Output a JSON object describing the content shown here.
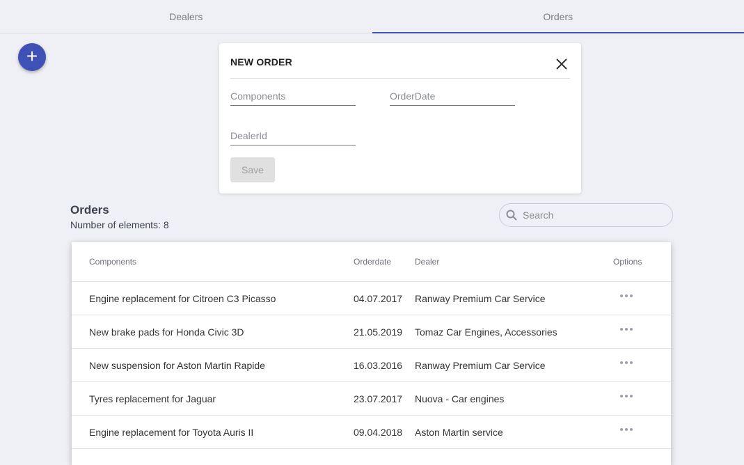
{
  "tabs": [
    {
      "label": "Dealers",
      "active": false
    },
    {
      "label": "Orders",
      "active": true
    }
  ],
  "colors": {
    "accent": "#3f51b5"
  },
  "fab": {
    "icon": "plus-icon",
    "label": "+"
  },
  "dialog": {
    "title": "NEW ORDER",
    "close_icon": "close-icon",
    "fields": {
      "components": {
        "placeholder": "Components",
        "value": ""
      },
      "order_date": {
        "placeholder": "OrderDate",
        "value": ""
      },
      "dealer_id": {
        "placeholder": "DealerId",
        "value": ""
      }
    },
    "save_label": "Save"
  },
  "orders": {
    "title": "Orders",
    "count_text": "Number of elements: 8",
    "search": {
      "placeholder": "Search",
      "icon": "search-icon"
    },
    "columns": [
      "Components",
      "Orderdate",
      "Dealer",
      "Options"
    ],
    "rows": [
      {
        "components": "Engine replacement for Citroen C3 Picasso",
        "date": "04.07.2017",
        "dealer": "Ranway Premium Car Service"
      },
      {
        "components": "New brake pads for Honda Civic 3D",
        "date": "21.05.2019",
        "dealer": "Tomaz Car Engines, Accessories"
      },
      {
        "components": "New suspension for Aston Martin Rapide",
        "date": "16.03.2016",
        "dealer": "Ranway Premium Car Service"
      },
      {
        "components": "Tyres replacement for Jaguar",
        "date": "23.07.2017",
        "dealer": "Nuova - Car engines"
      },
      {
        "components": "Engine replacement for Toyota Auris II",
        "date": "09.04.2018",
        "dealer": "Aston Martin service"
      }
    ],
    "options_icon": "more-horizontal-icon"
  }
}
